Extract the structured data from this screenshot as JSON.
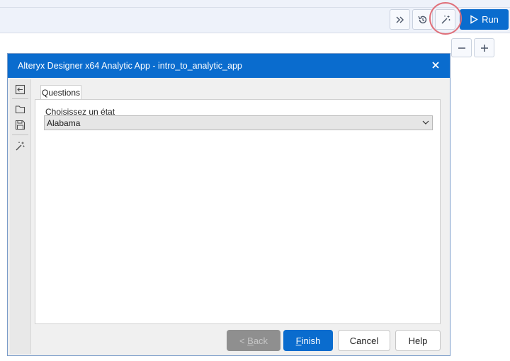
{
  "toolbar": {
    "run_label": "Run",
    "icons": [
      "double-chevron-right-icon",
      "history-icon",
      "magic-wand-icon",
      "play-icon"
    ],
    "accent_color": "#0a6cce",
    "highlight_color": "#e0707a"
  },
  "zoom": {
    "icons": [
      "minus-icon",
      "plus-icon"
    ]
  },
  "dialog": {
    "title": "Alteryx Designer x64 Analytic App - intro_to_analytic_app",
    "close_glyph": "×",
    "side_icons": [
      "collapse-icon",
      "folder-open-icon",
      "save-icon",
      "magic-wand-icon"
    ],
    "tab_label": "Questions",
    "question_label": "Choisissez un état",
    "select_value": "Alabama",
    "buttons": {
      "back_prefix": "< ",
      "back_mnemonic": "B",
      "back_rest": "ack",
      "finish_mnemonic": "F",
      "finish_rest": "inish",
      "cancel": "Cancel",
      "help": "Help"
    }
  }
}
